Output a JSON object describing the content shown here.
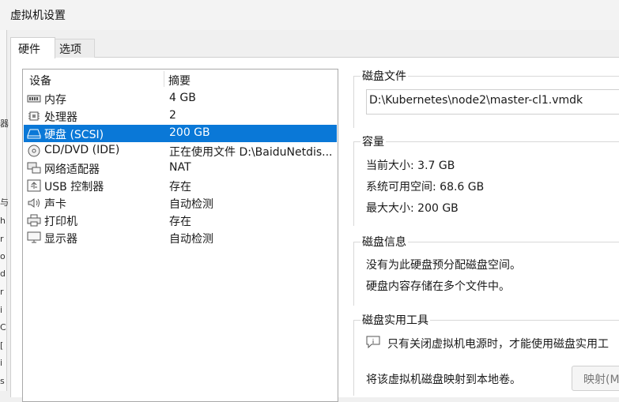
{
  "window": {
    "title": "虚拟机设置"
  },
  "left_edge_fragments": [
    "器",
    "与",
    "h",
    "r",
    "o",
    "d",
    "r",
    "i",
    "C",
    "[",
    "i",
    "s"
  ],
  "tabs": [
    {
      "label": "硬件",
      "active": true
    },
    {
      "label": "选项",
      "active": false
    }
  ],
  "device_list": {
    "headers": {
      "device": "设备",
      "summary": "摘要"
    },
    "rows": [
      {
        "name": "内存",
        "summary": "4 GB",
        "icon": "memory-icon"
      },
      {
        "name": "处理器",
        "summary": "2",
        "icon": "processor-icon"
      },
      {
        "name": "硬盘 (SCSI)",
        "summary": "200 GB",
        "icon": "harddisk-icon",
        "selected": true
      },
      {
        "name": "CD/DVD (IDE)",
        "summary": "正在使用文件 D:\\BaiduNetdis...",
        "icon": "cdrom-icon"
      },
      {
        "name": "网络适配器",
        "summary": "NAT",
        "icon": "network-icon"
      },
      {
        "name": "USB 控制器",
        "summary": "存在",
        "icon": "usb-icon"
      },
      {
        "name": "声卡",
        "summary": "自动检测",
        "icon": "speaker-icon"
      },
      {
        "name": "打印机",
        "summary": "存在",
        "icon": "printer-icon"
      },
      {
        "name": "显示器",
        "summary": "自动检测",
        "icon": "monitor-icon"
      }
    ]
  },
  "disk_file": {
    "title": "磁盘文件",
    "path": "D:\\Kubernetes\\node2\\master-cl1.vmdk"
  },
  "capacity": {
    "title": "容量",
    "current": "当前大小: 3.7 GB",
    "available": "系统可用空间: 68.6 GB",
    "max": "最大大小: 200 GB"
  },
  "disk_info": {
    "title": "磁盘信息",
    "line1": "没有为此硬盘预分配磁盘空间。",
    "line2": "硬盘内容存储在多个文件中。"
  },
  "disk_tools": {
    "title": "磁盘实用工具",
    "note": "只有关闭虚拟机电源时，才能使用磁盘实用工",
    "map_text": "将该虚拟机磁盘映射到本地卷。",
    "map_button": "映射(M"
  },
  "colors": {
    "selection": "#0a78d7",
    "window_bg": "#f0f0f0"
  }
}
